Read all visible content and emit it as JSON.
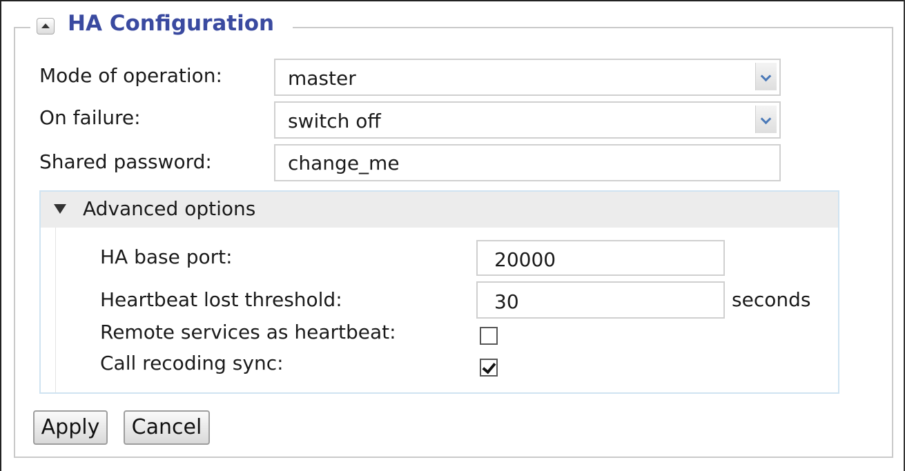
{
  "section": {
    "title": "HA Configuration",
    "collapse_icon": "collapse-up-triangle-icon"
  },
  "fields": {
    "mode_label": "Mode of operation:",
    "mode_value": "master",
    "failure_label": "On failure:",
    "failure_value": "switch off",
    "password_label": "Shared password:",
    "password_value": "change_me"
  },
  "advanced": {
    "title": "Advanced options",
    "expanded": true,
    "port_label": "HA base port:",
    "port_value": "20000",
    "heartbeat_label": "Heartbeat lost threshold:",
    "heartbeat_value": "30",
    "heartbeat_unit": "seconds",
    "remote_label": "Remote services as heartbeat:",
    "remote_checked": false,
    "sync_label": "Call recoding sync:",
    "sync_checked": true
  },
  "actions": {
    "apply_label": "Apply",
    "cancel_label": "Cancel"
  },
  "colors": {
    "title": "#3a4aa0",
    "dropdown_arrow": "#4a79b8",
    "advanced_border": "#cfe3f1",
    "advanced_header_bg": "#ececec"
  }
}
